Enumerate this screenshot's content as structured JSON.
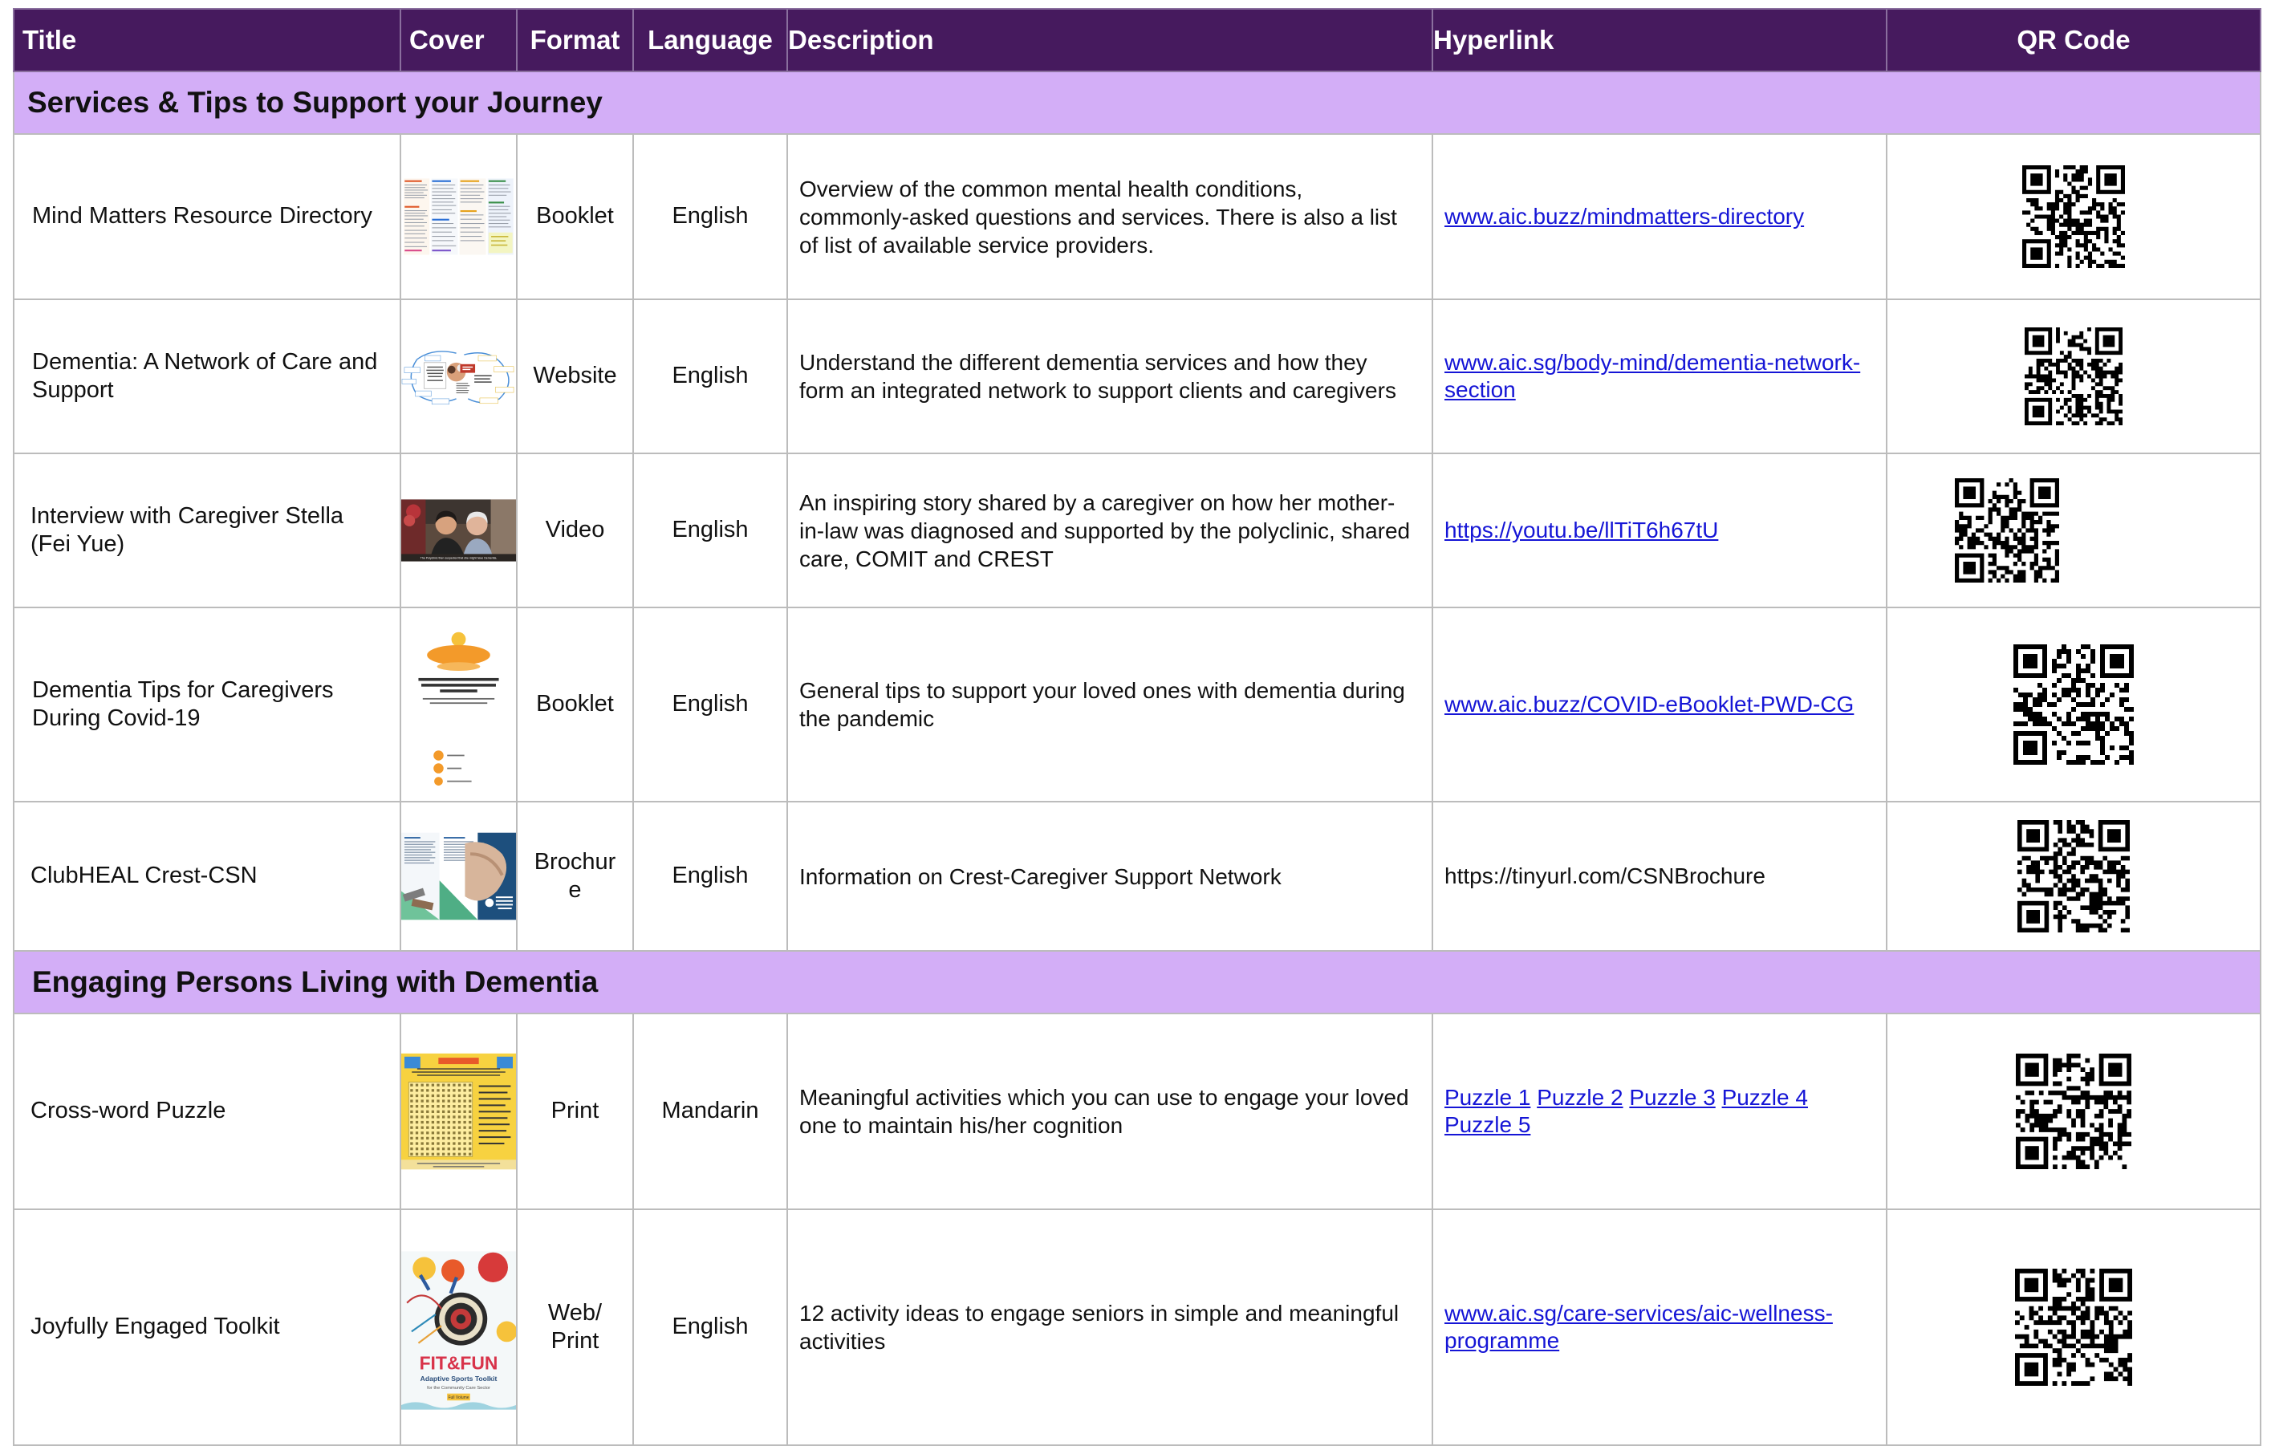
{
  "headers": {
    "title": "Title",
    "cover": "Cover",
    "format": "Format",
    "language": "Language",
    "description": "Description",
    "hyperlink": "Hyperlink",
    "qr_code": "QR Code"
  },
  "sections": [
    {
      "heading": "Services & Tips to Support your Journey",
      "rows": [
        {
          "title": "Mind Matters Resource Directory",
          "format": "Booklet",
          "language": "English",
          "description": "Overview of the common mental health conditions, commonly-asked questions and services. There is also a list of list of available service providers.",
          "links": [
            "www.aic.buzz/mindmatters-directory"
          ]
        },
        {
          "title": "Dementia: A Network of Care and Support",
          "format": "Website",
          "language": "English",
          "description": "Understand the different dementia services and how they form an integrated network to support clients and caregivers",
          "links": [
            "www.aic.sg/body-mind/dementia-network-section"
          ]
        },
        {
          "title": "Interview with Caregiver Stella (Fei Yue)",
          "format": "Video",
          "language": "English",
          "description": "An inspiring story shared by a caregiver on how her mother-in-law was diagnosed and supported by the polyclinic, shared care, COMIT and CREST",
          "links": [
            "https://youtu.be/llTiT6h67tU"
          ],
          "cover_caption": "The Polyclinic then suspected that she might have Dementia."
        },
        {
          "title": "Dementia Tips for Caregivers During Covid-19",
          "format": "Booklet",
          "language": "English",
          "description": "General tips to support your loved ones with dementia during the pandemic",
          "links": [
            "www.aic.buzz/COVID-eBooklet-PWD-CG"
          ]
        },
        {
          "title": "ClubHEAL Crest-CSN",
          "format": "Brochure",
          "language": "English",
          "description": "Information on Crest-Caregiver Support Network",
          "links": [
            "https://tinyurl.com/CSNBrochure"
          ],
          "link_plain": true
        }
      ]
    },
    {
      "heading": "Engaging Persons Living with Dementia",
      "rows": [
        {
          "title": "Cross-word Puzzle",
          "format": "Print",
          "language": "Mandarin",
          "description": "Meaningful activities which you can use to engage your loved one to maintain his/her cognition",
          "links": [
            "Puzzle 1",
            "Puzzle 2",
            "Puzzle 3",
            "Puzzle 4",
            "Puzzle 5"
          ]
        },
        {
          "title": "Joyfully Engaged Toolkit",
          "format": "Web/ Print",
          "language": "English",
          "description": "12 activity ideas to engage seniors in simple and meaningful activities",
          "links": [
            "www.aic.sg/care-services/aic-wellness-programme"
          ],
          "cover_text": [
            "FIT&FUN",
            "Adaptive Sports Toolkit",
            "for the Community Care Sector",
            "Full Volume"
          ]
        }
      ]
    }
  ],
  "colors": {
    "header_bg": "#461a5e",
    "section_bg": "#d3aef7",
    "link": "#1515d6",
    "grid": "#bcbcbc"
  },
  "icons": [
    "qr-code-icon"
  ]
}
